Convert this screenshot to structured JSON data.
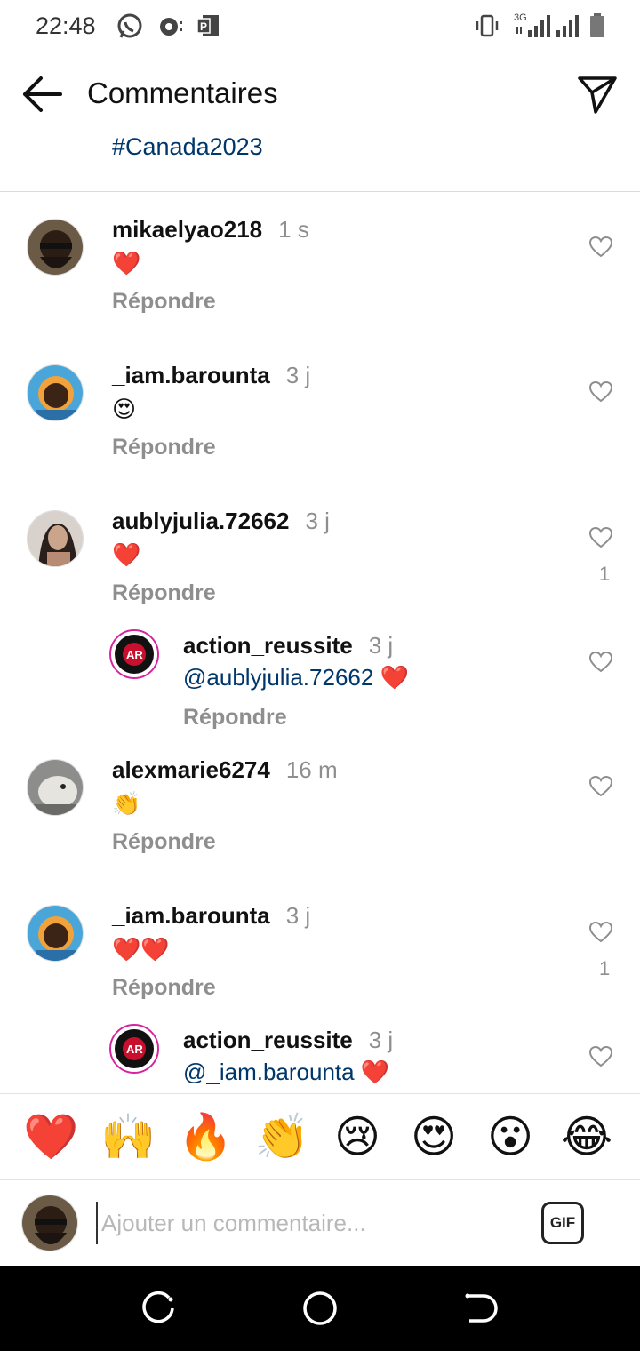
{
  "status_bar": {
    "time": "22:48",
    "network": "3G",
    "left_icons": [
      "whatsapp-icon",
      "camera-icon",
      "powerpoint-icon"
    ],
    "right_icons": [
      "vibrate-icon",
      "signal-icon",
      "signal-icon",
      "battery-icon"
    ]
  },
  "header": {
    "title": "Commentaires",
    "hashtag": "#Canada2023"
  },
  "comments": [
    {
      "username": "mikaelyao218",
      "time": "1 s",
      "text": "❤️",
      "reply_label": "Répondre"
    },
    {
      "username": "_iam.barounta",
      "time": "3 j",
      "text": "😍",
      "reply_label": "Répondre"
    },
    {
      "username": "aublyjulia.72662",
      "time": "3 j",
      "text": "❤️",
      "reply_label": "Répondre",
      "likes": "1"
    },
    {
      "username": "action_reussite",
      "time": "3 j",
      "mention": "@aublyjulia.72662",
      "text": " ❤️",
      "reply_label": "Répondre"
    },
    {
      "username": "alexmarie6274",
      "time": "16 m",
      "text": "👏",
      "reply_label": "Répondre"
    },
    {
      "username": "_iam.barounta",
      "time": "3 j",
      "text": "❤️❤️",
      "reply_label": "Répondre",
      "likes": "1"
    },
    {
      "username": "action_reussite",
      "time": "3 j",
      "mention": "@_iam.barounta",
      "text": " ❤️"
    }
  ],
  "emoji_bar": [
    "❤️",
    "🙌",
    "🔥",
    "👏",
    "😢",
    "😍",
    "😮",
    "😂"
  ],
  "composer": {
    "placeholder": "Ajouter un commentaire...",
    "gif_label": "GIF"
  },
  "colors": {
    "mention": "#00376b",
    "secondary_text": "#8e8e8e",
    "heart": "#ed1c24"
  }
}
